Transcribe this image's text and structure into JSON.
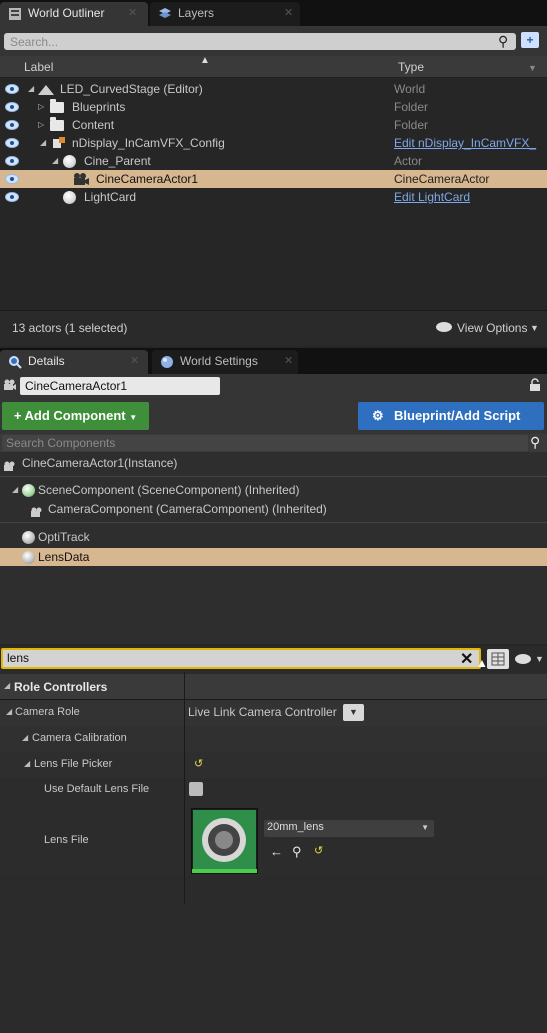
{
  "outliner": {
    "tabs": [
      {
        "label": "World Outliner"
      },
      {
        "label": "Layers"
      }
    ],
    "search_placeholder": "Search...",
    "col_label": "Label",
    "col_type": "Type",
    "rows": [
      {
        "label": "LED_CurvedStage (Editor)",
        "type": "World"
      },
      {
        "label": "Blueprints",
        "type": "Folder"
      },
      {
        "label": "Content",
        "type": "Folder"
      },
      {
        "label": "nDisplay_InCamVFX_Config",
        "type": "Edit nDisplay_InCamVFX_"
      },
      {
        "label": "Cine_Parent",
        "type": "Actor"
      },
      {
        "label": "CineCameraActor1",
        "type": "CineCameraActor"
      },
      {
        "label": "LightCard",
        "type": "Edit LightCard"
      }
    ],
    "status": "13 actors (1 selected)",
    "view_options": "View Options"
  },
  "details": {
    "tabs": [
      {
        "label": "Details"
      },
      {
        "label": "World Settings"
      }
    ],
    "actor_name": "CineCameraActor1",
    "add_component": "+ Add Component",
    "blueprint_script": "Blueprint/Add Script",
    "search_components_placeholder": "Search Components",
    "components": {
      "instance": "CineCameraActor1(Instance)",
      "scene": "SceneComponent (SceneComponent) (Inherited)",
      "camera": "CameraComponent (CameraComponent) (Inherited)",
      "optitrack": "OptiTrack",
      "lensdata": "LensData"
    },
    "filter_value": "lens",
    "properties": {
      "role_controllers": "Role Controllers",
      "camera_role_label": "Camera Role",
      "camera_role_value": "Live Link Camera Controller",
      "camera_calibration": "Camera Calibration",
      "lens_file_picker": "Lens File Picker",
      "use_default_lens_file": "Use Default Lens File",
      "lens_file_label": "Lens File",
      "lens_file_value": "20mm_lens"
    }
  },
  "colors": {
    "selection": "#d7b790",
    "link": "#7fa8e8",
    "green_button": "#3f8f3a",
    "blue_button": "#2f6fbf",
    "filter_border": "#e5b800"
  }
}
